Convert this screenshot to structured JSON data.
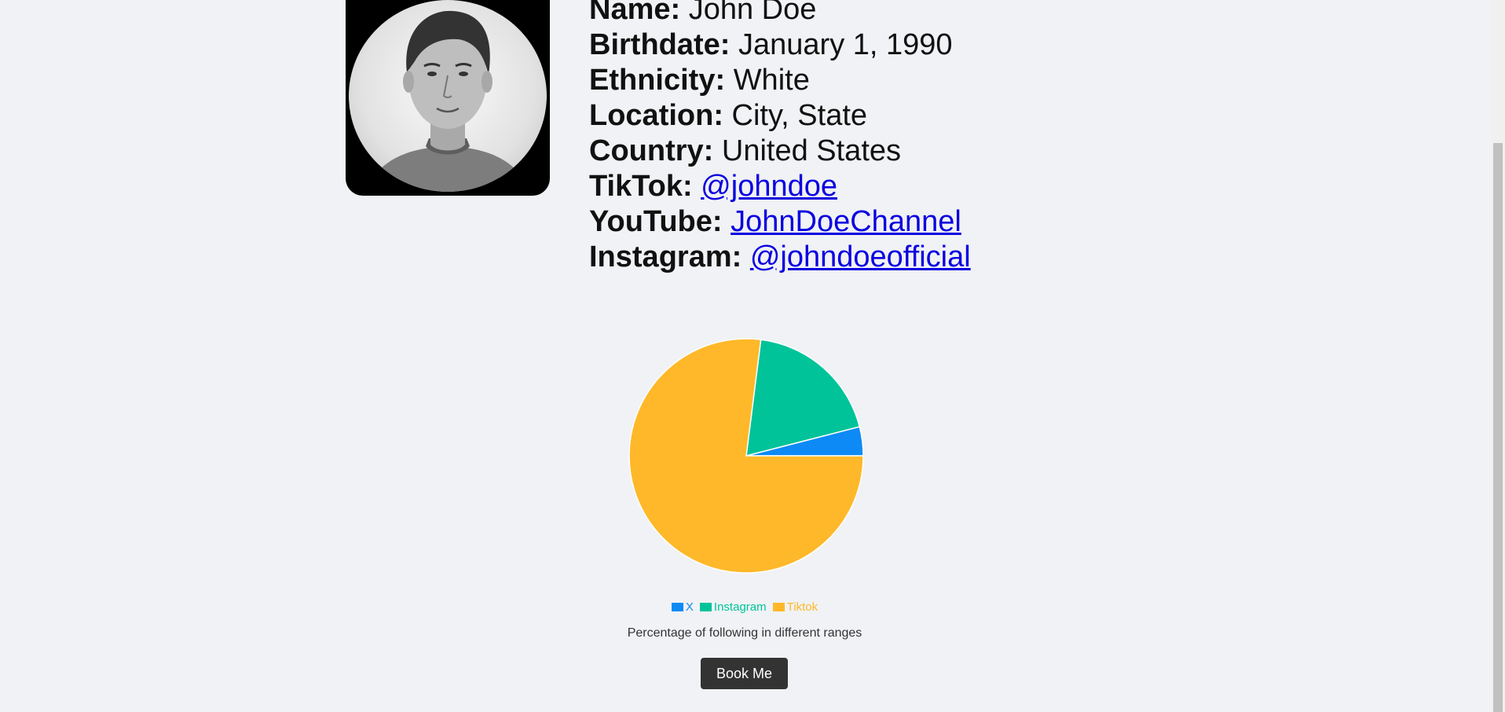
{
  "profile": {
    "rows": [
      {
        "label": "Name:",
        "value": "John Doe"
      },
      {
        "label": "Birthdate:",
        "value": "January 1, 1990"
      },
      {
        "label": "Ethnicity:",
        "value": "White"
      },
      {
        "label": "Location:",
        "value": "City, State"
      },
      {
        "label": "Country:",
        "value": "United States"
      },
      {
        "label": "TikTok:",
        "value": "@johndoe"
      },
      {
        "label": "YouTube:",
        "value": "JohnDoeChannel"
      },
      {
        "label": "Instagram:",
        "value": "@johndoeofficial"
      }
    ]
  },
  "chart_data": {
    "type": "pie",
    "categories": [
      "X",
      "Instagram",
      "Tiktok"
    ],
    "values": [
      4,
      19,
      77
    ],
    "colors": [
      "#0d8af5",
      "#00c39a",
      "#ffb829"
    ],
    "legend_position": "bottom",
    "caption": "Percentage of following in different ranges"
  },
  "actions": {
    "book_label": "Book Me"
  },
  "colors": {
    "background": "#f0f2f5",
    "link": "#0a00e0",
    "button": "#333333"
  }
}
